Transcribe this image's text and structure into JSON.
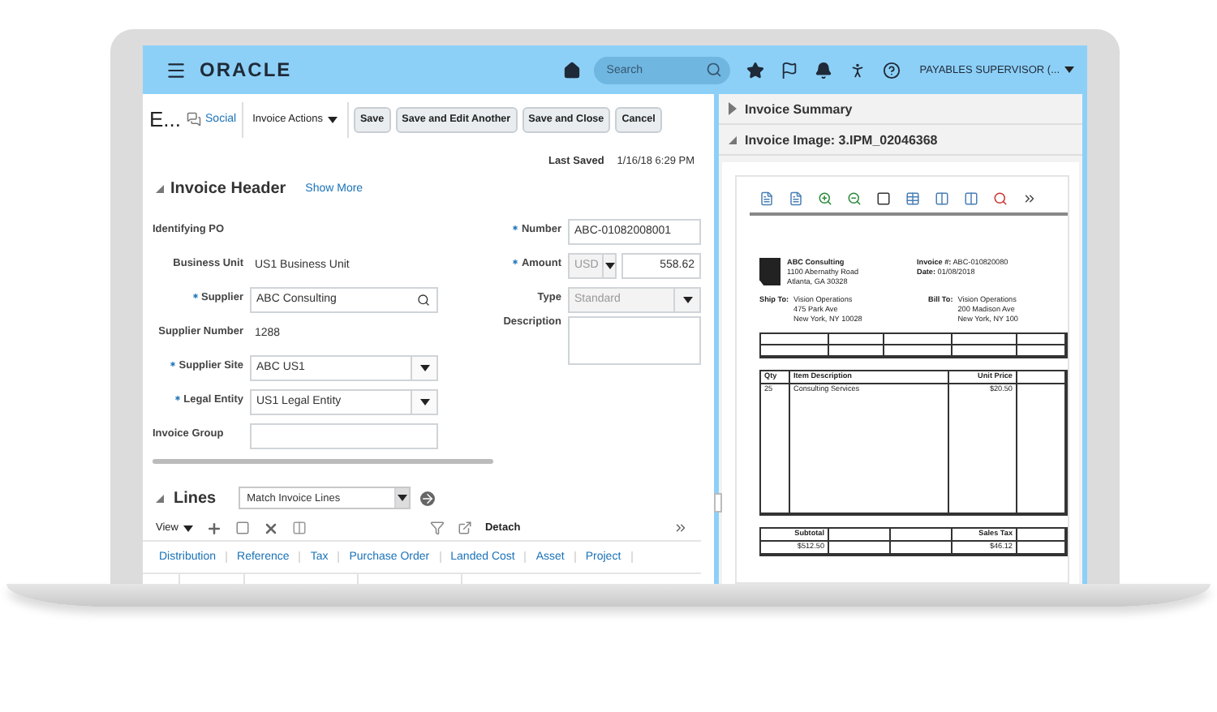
{
  "app_bar": {
    "logo": "ORACLE",
    "search": {
      "placeholder": "Search"
    },
    "user": "PAYABLES SUPERVISOR (..."
  },
  "toolbar": {
    "title": "E...",
    "social": "Social",
    "actions_menu": "Invoice Actions",
    "buttons": [
      "Save",
      "Save and Edit Another",
      "Save and Close",
      "Cancel"
    ]
  },
  "last_saved": {
    "label": "Last Saved",
    "value": "1/16/18 6:29 PM"
  },
  "invoice_header": {
    "title": "Invoice Header",
    "expanded": true,
    "show_more": "Show More",
    "left_fields": [
      {
        "label": "Identifying PO",
        "kind": "empty",
        "required": false
      },
      {
        "label": "Business Unit",
        "kind": "text",
        "required": false,
        "value": "US1 Business Unit"
      },
      {
        "label": "Supplier",
        "kind": "search",
        "required": true,
        "value": "ABC Consulting"
      },
      {
        "label": "Supplier Number",
        "kind": "text",
        "required": false,
        "value": "1288"
      },
      {
        "label": "Supplier Site",
        "kind": "select",
        "required": true,
        "value": "ABC US1"
      },
      {
        "label": "Legal Entity",
        "kind": "select",
        "required": true,
        "value": "US1 Legal Entity"
      },
      {
        "label": "Invoice Group",
        "kind": "input",
        "required": false
      }
    ],
    "right_fields": [
      {
        "label": "Number",
        "kind": "input",
        "required": true,
        "value": "ABC-01082008001"
      },
      {
        "label": "Amount",
        "kind": "amount",
        "required": true,
        "currency": "USD",
        "value": "558.62"
      },
      {
        "label": "Type",
        "kind": "select",
        "required": false,
        "disabled": true,
        "value": "Standard"
      },
      {
        "label": "Description",
        "kind": "textarea",
        "required": false
      }
    ]
  },
  "lines": {
    "title": "Lines",
    "expanded": true,
    "match_select": "Match Invoice Lines",
    "view_menu": "View",
    "detach": "Detach",
    "tabs": [
      "Distribution",
      "Reference",
      "Tax",
      "Purchase Order",
      "Landed Cost",
      "Asset",
      "Project"
    ]
  },
  "invoice_summary": {
    "title": "Invoice Summary",
    "expanded": false
  },
  "invoice_image": {
    "title": "Invoice Image: 3.IPM_02046368",
    "expanded": true,
    "document": {
      "company": "ABC Consulting",
      "address": [
        "1100 Abernathy Road",
        "Atlanta, GA 30328"
      ],
      "meta": [
        {
          "label": "Invoice #:",
          "value": "ABC-010820080"
        },
        {
          "label": "Date:",
          "value": "01/08/2018"
        }
      ],
      "ship_to": {
        "label": "Ship To:",
        "lines": [
          "Vision Operations",
          "475 Park Ave",
          "New York, NY 10028"
        ]
      },
      "bill_to": {
        "label": "Bill To:",
        "lines": [
          "Vision Operations",
          "200 Madison Ave",
          "New York, NY 100"
        ]
      },
      "item_columns": [
        "Qty",
        "Item Description",
        "Unit Price"
      ],
      "items": [
        {
          "qty": "25",
          "description": "Consulting Services",
          "unit_price": "$20.50"
        }
      ],
      "totals": [
        {
          "label": "Subtotal",
          "value": "$512.50"
        },
        {
          "label": "Sales Tax",
          "value": "$46.12"
        }
      ]
    }
  }
}
